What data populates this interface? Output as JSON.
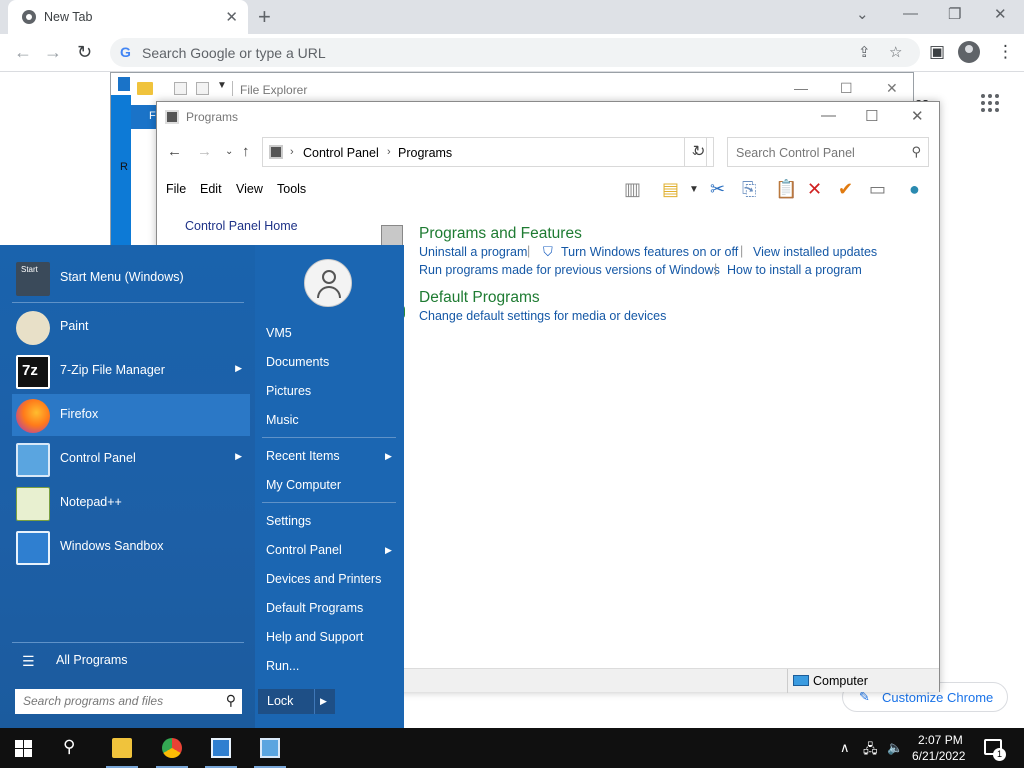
{
  "chrome": {
    "tab_title": "New Tab",
    "tab_close": "✕",
    "new_tab": "+",
    "omnibox_placeholder": "Search Google or type a URL",
    "content_partial_text": "es",
    "customize_label": "Customize Chrome"
  },
  "file_explorer": {
    "title": "File Explorer",
    "ribbon_partial": "F",
    "left_partial": "R"
  },
  "programs_window": {
    "title": "Programs",
    "breadcrumb": [
      "Control Panel",
      "Programs"
    ],
    "search_placeholder": "Search Control Panel",
    "menu": [
      "File",
      "Edit",
      "View",
      "Tools"
    ],
    "left_nav": "Control Panel Home",
    "sections": [
      {
        "heading": "Programs and Features",
        "links": [
          "Uninstall a program",
          "Turn Windows features on or off",
          "View installed updates",
          "Run programs made for previous versions of Windows",
          "How to install a program"
        ]
      },
      {
        "heading": "Default Programs",
        "links": [
          "Change default settings for media or devices"
        ]
      }
    ],
    "status_text": "Computer"
  },
  "start_menu": {
    "left_items": [
      {
        "label": "Start Menu (Windows)",
        "icon": "start-menu-icon",
        "arrow": false
      },
      {
        "label": "Paint",
        "icon": "paint-icon",
        "arrow": false
      },
      {
        "label": "7-Zip File Manager",
        "icon": "7zip-icon",
        "arrow": true
      },
      {
        "label": "Firefox",
        "icon": "firefox-icon",
        "arrow": false
      },
      {
        "label": "Control Panel",
        "icon": "control-panel-icon",
        "arrow": true
      },
      {
        "label": "Notepad++",
        "icon": "notepadpp-icon",
        "arrow": false
      },
      {
        "label": "Windows Sandbox",
        "icon": "windows-sandbox-icon",
        "arrow": false
      }
    ],
    "start_icon_text": "Start",
    "zip_icon_text": "7z",
    "all_programs": "All Programs",
    "search_placeholder": "Search programs and files",
    "right_items": [
      {
        "label": "VM5",
        "arrow": false
      },
      {
        "label": "Documents",
        "arrow": false
      },
      {
        "label": "Pictures",
        "arrow": false
      },
      {
        "label": "Music",
        "arrow": false
      },
      {
        "label": "Recent Items",
        "arrow": true
      },
      {
        "label": "My Computer",
        "arrow": false
      },
      {
        "label": "Settings",
        "arrow": false
      },
      {
        "label": "Control Panel",
        "arrow": true
      },
      {
        "label": "Devices and Printers",
        "arrow": false
      },
      {
        "label": "Default Programs",
        "arrow": false
      },
      {
        "label": "Help and Support",
        "arrow": false
      },
      {
        "label": "Run...",
        "arrow": false
      }
    ],
    "lock_label": "Lock"
  },
  "taskbar": {
    "time": "2:07 PM",
    "date": "6/21/2022",
    "notification_count": "1"
  },
  "colors": {
    "start_menu_blue": "#1d5fa6",
    "link_blue": "#1558a6",
    "heading_green": "#1e7b32",
    "taskbar": "#101010"
  }
}
